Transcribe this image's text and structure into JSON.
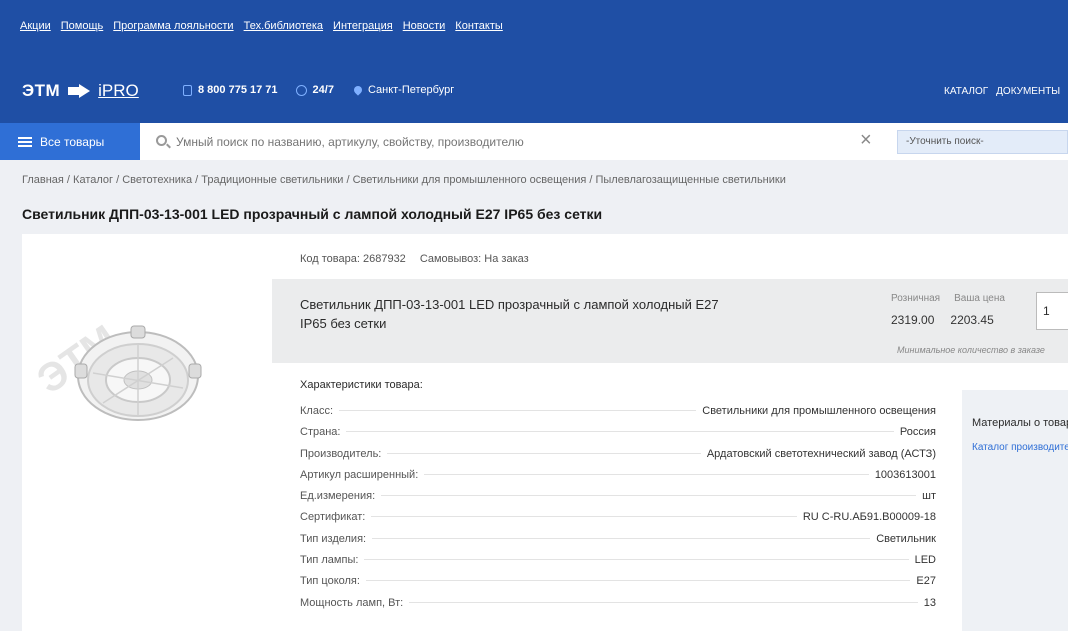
{
  "top_links": [
    "Акции",
    "Помощь",
    "Программа лояльности",
    "Тех.библиотека",
    "Интеграция",
    "Новости",
    "Контакты"
  ],
  "brand": {
    "logo_text": "ЭТМ",
    "ipro_text": "iPRO",
    "phone": "8 800 775 17 71",
    "hours": "24/7",
    "city": "Санкт-Петербург",
    "nav": [
      "КАТАЛОГ",
      "ДОКУМЕНТЫ"
    ]
  },
  "search": {
    "all_goods_label": "Все товары",
    "placeholder": "Умный поиск по названию, артикулу, свойству, производителю",
    "clear_symbol": "×",
    "refine_label": "-Уточнить поиск-"
  },
  "breadcrumb": "Главная / Каталог / Светотехника / Традиционные светильники / Светильники для промышленного освещения / Пылевлагозащищенные светильники",
  "title": "Светильник ДПП-03-13-001 LED прозрачный с лампой холодный E27 IP65 без сетки",
  "image": {
    "watermark": "ЭТМ"
  },
  "meta": {
    "code": "Код товара: 2687932",
    "pickup": "Самовывоз: На заказ"
  },
  "price_panel": {
    "name": "Светильник ДПП-03-13-001 LED прозрачный с лампой холодный E27 IP65 без сетки",
    "retail_label": "Розничная",
    "your_price_label": "Ваша цена",
    "retail_value": "2319.00",
    "your_value": "2203.45",
    "qty": "1",
    "min_qty_note": "Минимальное количество в заказе"
  },
  "characteristics": {
    "heading": "Характеристики товара:",
    "rows": [
      {
        "k": "Класс:",
        "v": "Светильники для промышленного освещения"
      },
      {
        "k": "Страна:",
        "v": "Россия"
      },
      {
        "k": "Производитель:",
        "v": "Ардатовский светотехнический завод (АСТЗ)"
      },
      {
        "k": "Артикул расширенный:",
        "v": "1003613001"
      },
      {
        "k": "Ед.измерения:",
        "v": "шт"
      },
      {
        "k": "Сертификат:",
        "v": "RU C-RU.АБ91.В00009-18"
      },
      {
        "k": "Тип изделия:",
        "v": "Светильник"
      },
      {
        "k": "Тип лампы:",
        "v": "LED"
      },
      {
        "k": "Тип цоколя:",
        "v": "E27"
      },
      {
        "k": "Мощность ламп, Вт:",
        "v": "13"
      }
    ]
  },
  "materials": {
    "heading": "Материалы о товаре",
    "link": "Каталог производителя"
  }
}
